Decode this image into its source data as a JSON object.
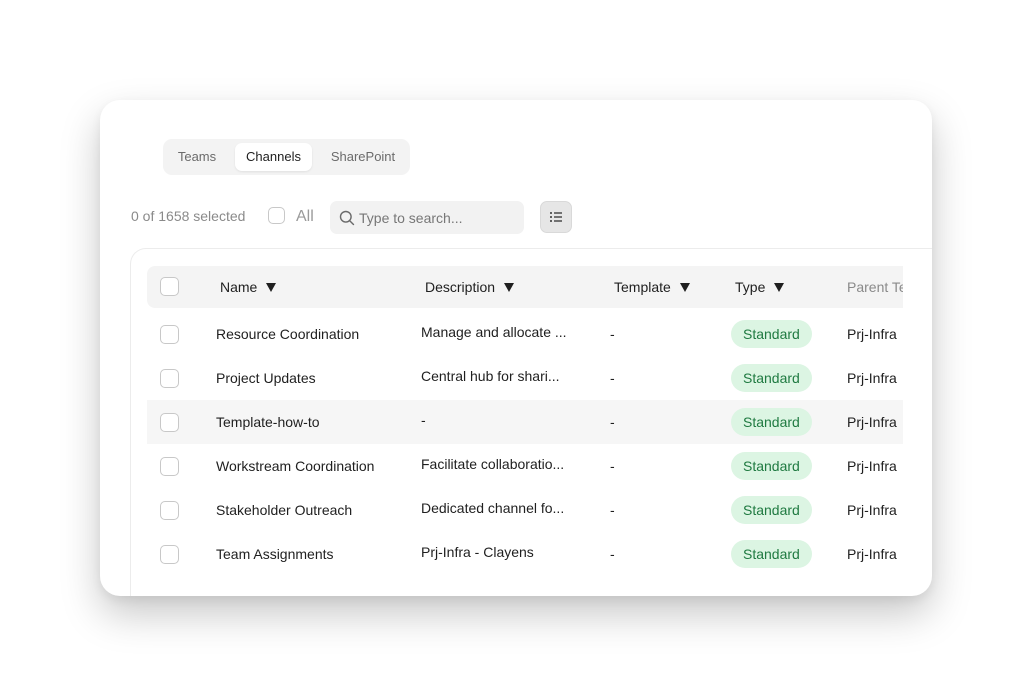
{
  "tabs": [
    {
      "label": "Teams",
      "active": false
    },
    {
      "label": "Channels",
      "active": true
    },
    {
      "label": "SharePoint",
      "active": false
    }
  ],
  "toolbar": {
    "selection_text": "0 of 1658 selected",
    "all_label": "All",
    "search_placeholder": "Type to search..."
  },
  "table": {
    "columns": [
      "Name",
      "Description",
      "Template",
      "Type",
      "Parent Te"
    ],
    "rows": [
      {
        "name": "Resource Coordination",
        "description": "Manage and allocate ...",
        "template": "-",
        "type": "Standard",
        "parent": "Prj-Infra"
      },
      {
        "name": "Project Updates",
        "description": "Central hub for shari...",
        "template": "-",
        "type": "Standard",
        "parent": "Prj-Infra"
      },
      {
        "name": "Template-how-to",
        "description": "-",
        "template": "-",
        "type": "Standard",
        "parent": "Prj-Infra"
      },
      {
        "name": "Workstream Coordination",
        "description": "Facilitate collaboratio...",
        "template": "-",
        "type": "Standard",
        "parent": "Prj-Infra"
      },
      {
        "name": "Stakeholder Outreach",
        "description": "Dedicated channel fo...",
        "template": "-",
        "type": "Standard",
        "parent": "Prj-Infra"
      },
      {
        "name": "Team Assignments",
        "description": "Prj-Infra - Clayens",
        "template": "-",
        "type": "Standard",
        "parent": "Prj-Infra"
      }
    ]
  },
  "colors": {
    "badge_bg": "#dcf5e3",
    "badge_text": "#1f7a41"
  }
}
